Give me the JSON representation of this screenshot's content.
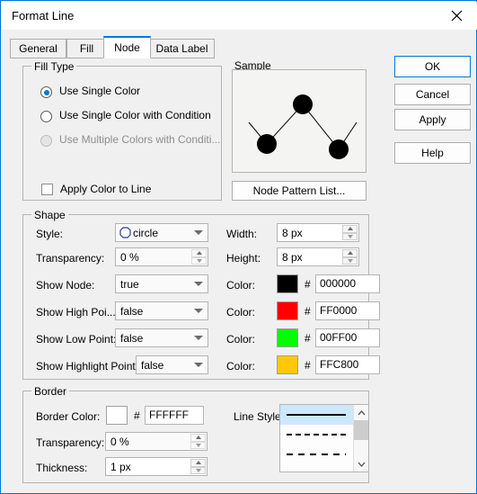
{
  "window": {
    "title": "Format Line",
    "close_icon": "close-icon",
    "accent_color": "#0078d7"
  },
  "tabs": [
    {
      "label": "General",
      "active": false
    },
    {
      "label": "Fill",
      "active": false
    },
    {
      "label": "Node",
      "active": true
    },
    {
      "label": "Data Label",
      "active": false
    }
  ],
  "buttons": {
    "ok": "OK",
    "cancel": "Cancel",
    "apply": "Apply",
    "help": "Help"
  },
  "fill_type": {
    "title": "Fill Type",
    "options": [
      {
        "label": "Use Single Color",
        "checked": true,
        "disabled": false
      },
      {
        "label": "Use Single Color with Condition",
        "checked": false,
        "disabled": false
      },
      {
        "label": "Use Multiple Colors with Conditi...",
        "checked": false,
        "disabled": true
      }
    ],
    "apply_color_to_line": {
      "label": "Apply Color to Line",
      "checked": false
    }
  },
  "sample": {
    "title": "Sample",
    "node_pattern_button": "Node Pattern List...",
    "node_color": "#000000"
  },
  "shape": {
    "title": "Shape",
    "style": {
      "label": "Style:",
      "value": "circle",
      "icon": "circle-outline-icon"
    },
    "transparency": {
      "label": "Transparency:",
      "value": "0 %"
    },
    "width": {
      "label": "Width:",
      "value": "8 px"
    },
    "height": {
      "label": "Height:",
      "value": "8 px"
    },
    "rows": [
      {
        "label": "Show Node:",
        "value": "true",
        "color_label": "Color:",
        "color": "#000000",
        "hex": "000000"
      },
      {
        "label": "Show High Poi...",
        "value": "false",
        "color_label": "Color:",
        "color": "#FF0000",
        "hex": "FF0000"
      },
      {
        "label": "Show Low Point:",
        "value": "false",
        "color_label": "Color:",
        "color": "#00FF00",
        "hex": "00FF00"
      },
      {
        "label": "Show Highlight Point:",
        "value": "false",
        "color_label": "Color:",
        "color": "#FFC800",
        "hex": "FFC800"
      }
    ]
  },
  "border": {
    "title": "Border",
    "border_color": {
      "label": "Border Color:",
      "color": "#FFFFFF",
      "hex": "FFFFFF"
    },
    "transparency": {
      "label": "Transparency:",
      "value": "0 %"
    },
    "thickness": {
      "label": "Thickness:",
      "value": "1 px"
    },
    "line_style": {
      "label": "Line Style:",
      "items": [
        {
          "style": "solid",
          "selected": true
        },
        {
          "style": "dotted",
          "selected": false
        },
        {
          "style": "dashed-small",
          "selected": false
        },
        {
          "style": "dashed-large",
          "selected": false
        }
      ],
      "scroll_up_icon": "chevron-up-icon",
      "scroll_down_icon": "chevron-down-icon"
    }
  }
}
